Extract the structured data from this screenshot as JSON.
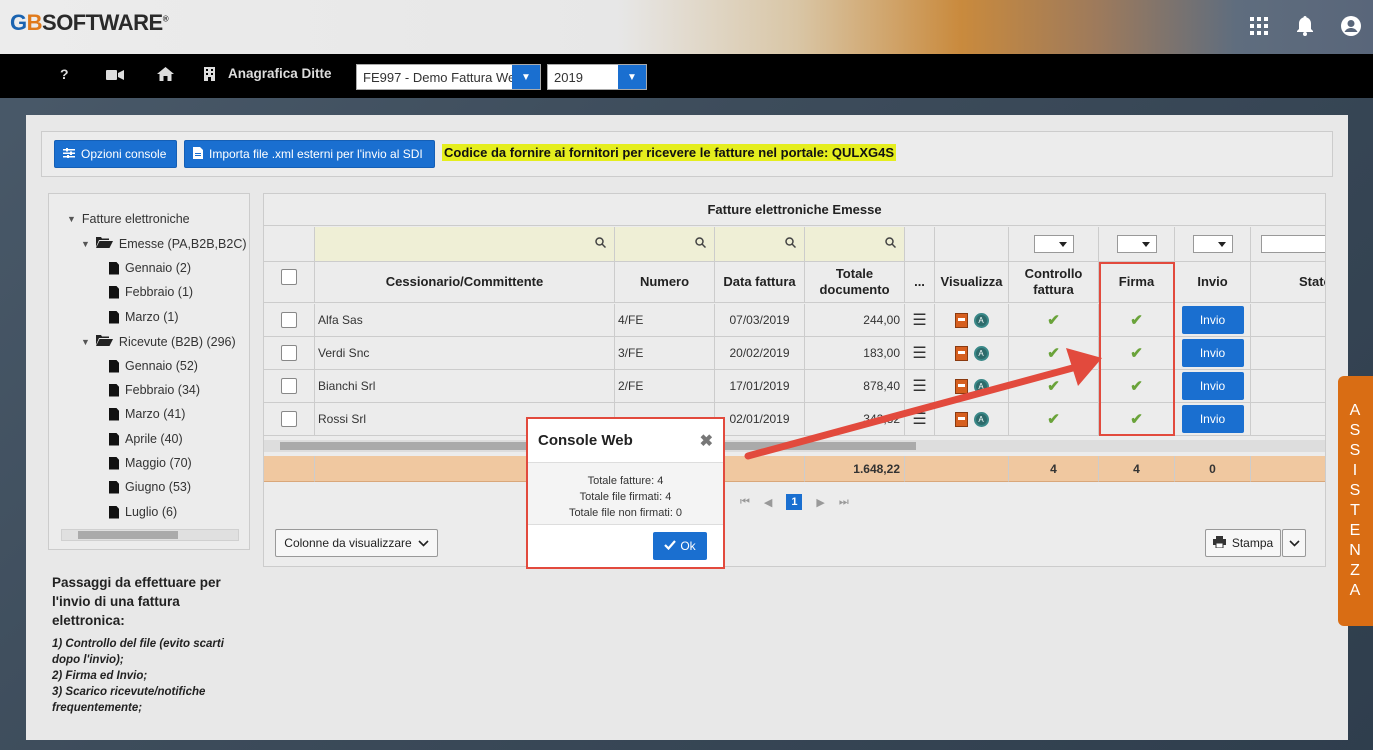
{
  "header": {
    "logo_g": "G",
    "logo_b": "B",
    "logo_rest": "SOFTWARE",
    "logo_mark": "®",
    "icons": [
      "apps-grid-icon",
      "bell-icon",
      "account-icon"
    ]
  },
  "nav": {
    "help": "?",
    "title": "Anagrafica Ditte",
    "company_select": "FE997 - Demo Fattura We",
    "year_select": "2019"
  },
  "toolbar": {
    "opzioni_label": "Opzioni console",
    "importa_label": "Importa file .xml esterni per l'invio al SDI",
    "codice_text": "Codice da fornire ai fornitori per ricevere le fatture nel portale: QULXG4S"
  },
  "tree": {
    "root": "Fatture elettroniche",
    "emesse": "Emesse (PA,B2B,B2C)",
    "emesse_items": [
      "Gennaio (2)",
      "Febbraio (1)",
      "Marzo (1)"
    ],
    "ricevute": "Ricevute (B2B) (296)",
    "ricevute_items": [
      "Gennaio (52)",
      "Febbraio (34)",
      "Marzo (41)",
      "Aprile (40)",
      "Maggio (70)",
      "Giugno (53)",
      "Luglio (6)"
    ]
  },
  "info": {
    "title": "Passaggi da effettuare per l'invio di una fattura elettronica:",
    "step1": "1) Controllo del file (evito scarti dopo l'invio);",
    "step2": "2) Firma ed Invio;",
    "step3": "3) Scarico ricevute/notifiche frequentemente;"
  },
  "grid": {
    "title": "Fatture elettroniche Emesse",
    "headers": {
      "cessionario": "Cessionario/Committente",
      "numero": "Numero",
      "data": "Data fattura",
      "totale": "Totale documento",
      "more": "...",
      "visualizza": "Visualizza",
      "controllo": "Controllo fattura",
      "firma": "Firma",
      "invio": "Invio",
      "stato": "Stato"
    },
    "rows": [
      {
        "cessionario": "Alfa Sas",
        "numero": "4/FE",
        "data": "07/03/2019",
        "totale": "244,00",
        "invio": "Invio"
      },
      {
        "cessionario": "Verdi Snc",
        "numero": "3/FE",
        "data": "20/02/2019",
        "totale": "183,00",
        "invio": "Invio"
      },
      {
        "cessionario": "Bianchi Srl",
        "numero": "2/FE",
        "data": "17/01/2019",
        "totale": "878,40",
        "invio": "Invio"
      },
      {
        "cessionario": "Rossi Srl",
        "numero": "",
        "data": "02/01/2019",
        "totale": "342,82",
        "invio": "Invio"
      }
    ],
    "totals": {
      "totale": "1.648,22",
      "controllo": "4",
      "firma": "4",
      "invio": "0"
    },
    "page": "1"
  },
  "bottom": {
    "colonne_label": "Colonne da visualizzare",
    "stampa_label": "Stampa"
  },
  "dialog": {
    "title": "Console Web",
    "close": "✖",
    "line1": "Totale fatture: 4",
    "line2": "Totale file firmati: 4",
    "line3": "Totale file non firmati: 0",
    "ok_label": "Ok"
  },
  "assistenza": [
    "A",
    "S",
    "S",
    "I",
    "S",
    "T",
    "E",
    "N",
    "Z",
    "A"
  ],
  "colors": {
    "accent": "#1a6fd0",
    "highlight": "#e24a3d",
    "assist": "#d96d14",
    "codice_bg": "#e5ee1e"
  }
}
